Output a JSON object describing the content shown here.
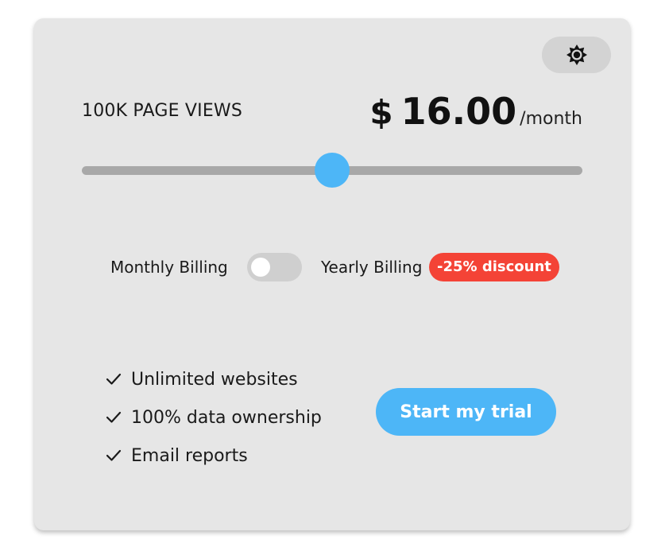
{
  "pricing": {
    "pageviews_label": "100K PAGE VIEWS",
    "currency": "$",
    "amount": "16.00",
    "period": "/month"
  },
  "slider": {
    "value_fraction": 0.5
  },
  "billing": {
    "monthly_label": "Monthly Billing",
    "yearly_label": "Yearly Billing",
    "discount_badge": "-25% discount",
    "yearly_selected": false
  },
  "features": [
    "Unlimited websites",
    "100% data ownership",
    "Email reports"
  ],
  "cta_label": "Start my trial",
  "icons": {
    "theme_toggle": "sun-icon",
    "feature_bullet": "check-icon"
  },
  "colors": {
    "accent": "#4db6f7",
    "discount": "#f44336",
    "card_background": "#e6e6e6"
  }
}
